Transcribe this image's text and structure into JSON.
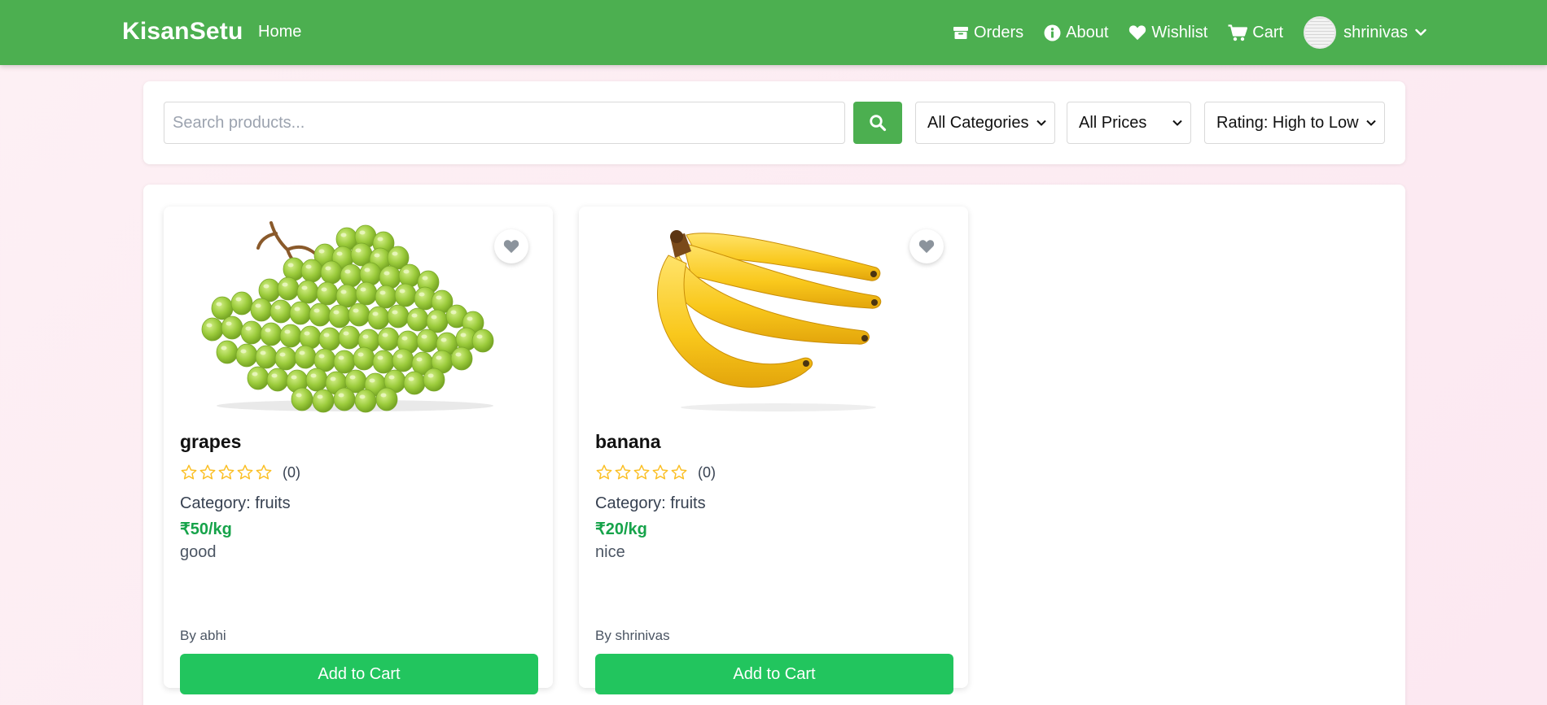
{
  "nav": {
    "brand": "KisanSetu",
    "home": "Home",
    "orders": "Orders",
    "about": "About",
    "wishlist": "Wishlist",
    "cart": "Cart",
    "username": "shrinivas",
    "icons": [
      "box-icon",
      "info-icon",
      "heart-icon",
      "cart-icon",
      "chevron-down-icon"
    ]
  },
  "search": {
    "placeholder": "Search products...",
    "value": "",
    "category": "All Categories",
    "price": "All Prices",
    "sort": "Rating: High to Low"
  },
  "products": [
    {
      "name": "grapes",
      "rating_stars": 0,
      "rating_count": "(0)",
      "category": "Category: fruits",
      "price": "₹50/kg",
      "description": "good",
      "seller": "By abhi",
      "button": "Add to Cart",
      "image": "green-grapes-image"
    },
    {
      "name": "banana",
      "rating_stars": 0,
      "rating_count": "(0)",
      "category": "Category: fruits",
      "price": "₹20/kg",
      "description": "nice",
      "seller": "By shrinivas",
      "button": "Add to Cart",
      "image": "banana-bunch-image"
    }
  ],
  "colors": {
    "navbar": "#4caf50",
    "button": "#22c55e",
    "price": "#16a34a",
    "star": "#fbbf24"
  }
}
